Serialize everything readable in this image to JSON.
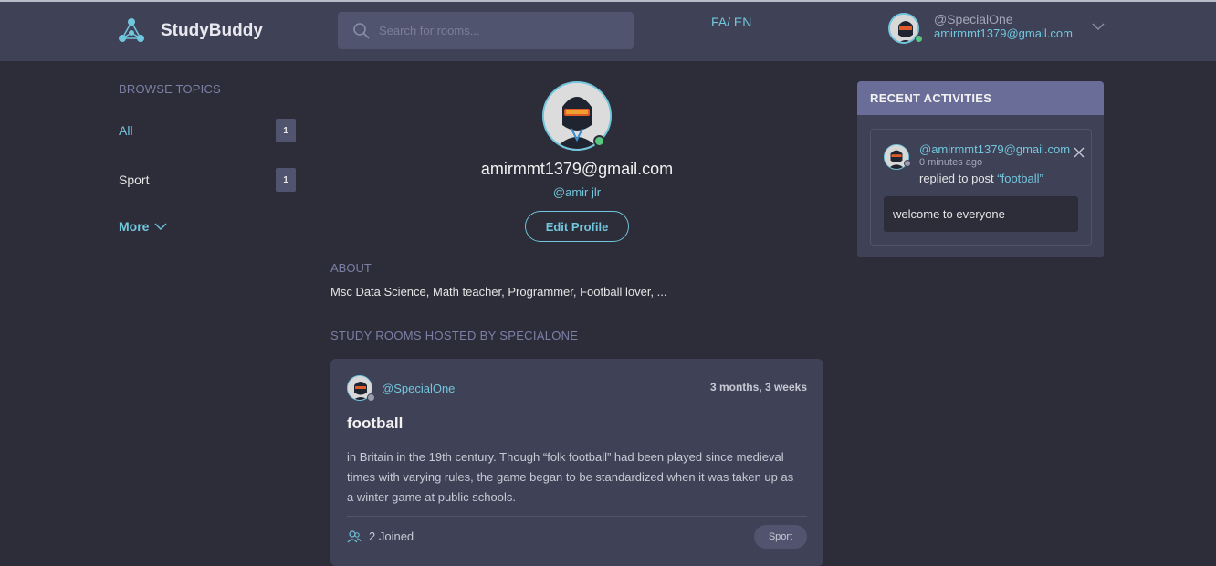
{
  "header": {
    "app_name": "StudyBuddy",
    "search_placeholder": "Search for rooms...",
    "language_toggle": "FA/ EN",
    "user_handle": "@SpecialOne",
    "user_email": "amirmmt1379@gmail.com",
    "icons": [
      "logo-icon",
      "search-icon",
      "chevron-down-icon"
    ]
  },
  "topics": {
    "title": "BROWSE TOPICS",
    "items": [
      {
        "label": "All",
        "count": "1"
      },
      {
        "label": "Sport",
        "count": "1"
      }
    ],
    "more_label": "More"
  },
  "profile": {
    "email": "amirmmt1379@gmail.com",
    "handle": "@amir jlr",
    "edit_label": "Edit Profile",
    "about_title": "ABOUT",
    "about_text": "Msc Data Science, Math teacher, Programmer, Football lover, ...",
    "hosted_title": "STUDY ROOMS HOSTED BY SPECIALONE"
  },
  "room": {
    "host": "@SpecialOne",
    "time": "3 months, 3 weeks",
    "title": "football",
    "description": "in Britain in the 19th century. Though “folk football” had been played since medieval times with varying rules, the game began to be standardized when it was taken up as a winter game at public schools.",
    "joined": "2 Joined",
    "tag": "Sport"
  },
  "activities": {
    "title": "RECENT ACTIVITIES",
    "items": [
      {
        "user": "@amirmmt1379@gmail.com",
        "time": "0 minutes ago",
        "action": "replied to post ",
        "post": "“football”",
        "message": "welcome to everyone"
      }
    ]
  },
  "colors": {
    "background": "#2d2d39",
    "panel": "#3f4156",
    "accent": "#71c6dd",
    "online": "#59c780",
    "activity_header": "#696d97"
  }
}
